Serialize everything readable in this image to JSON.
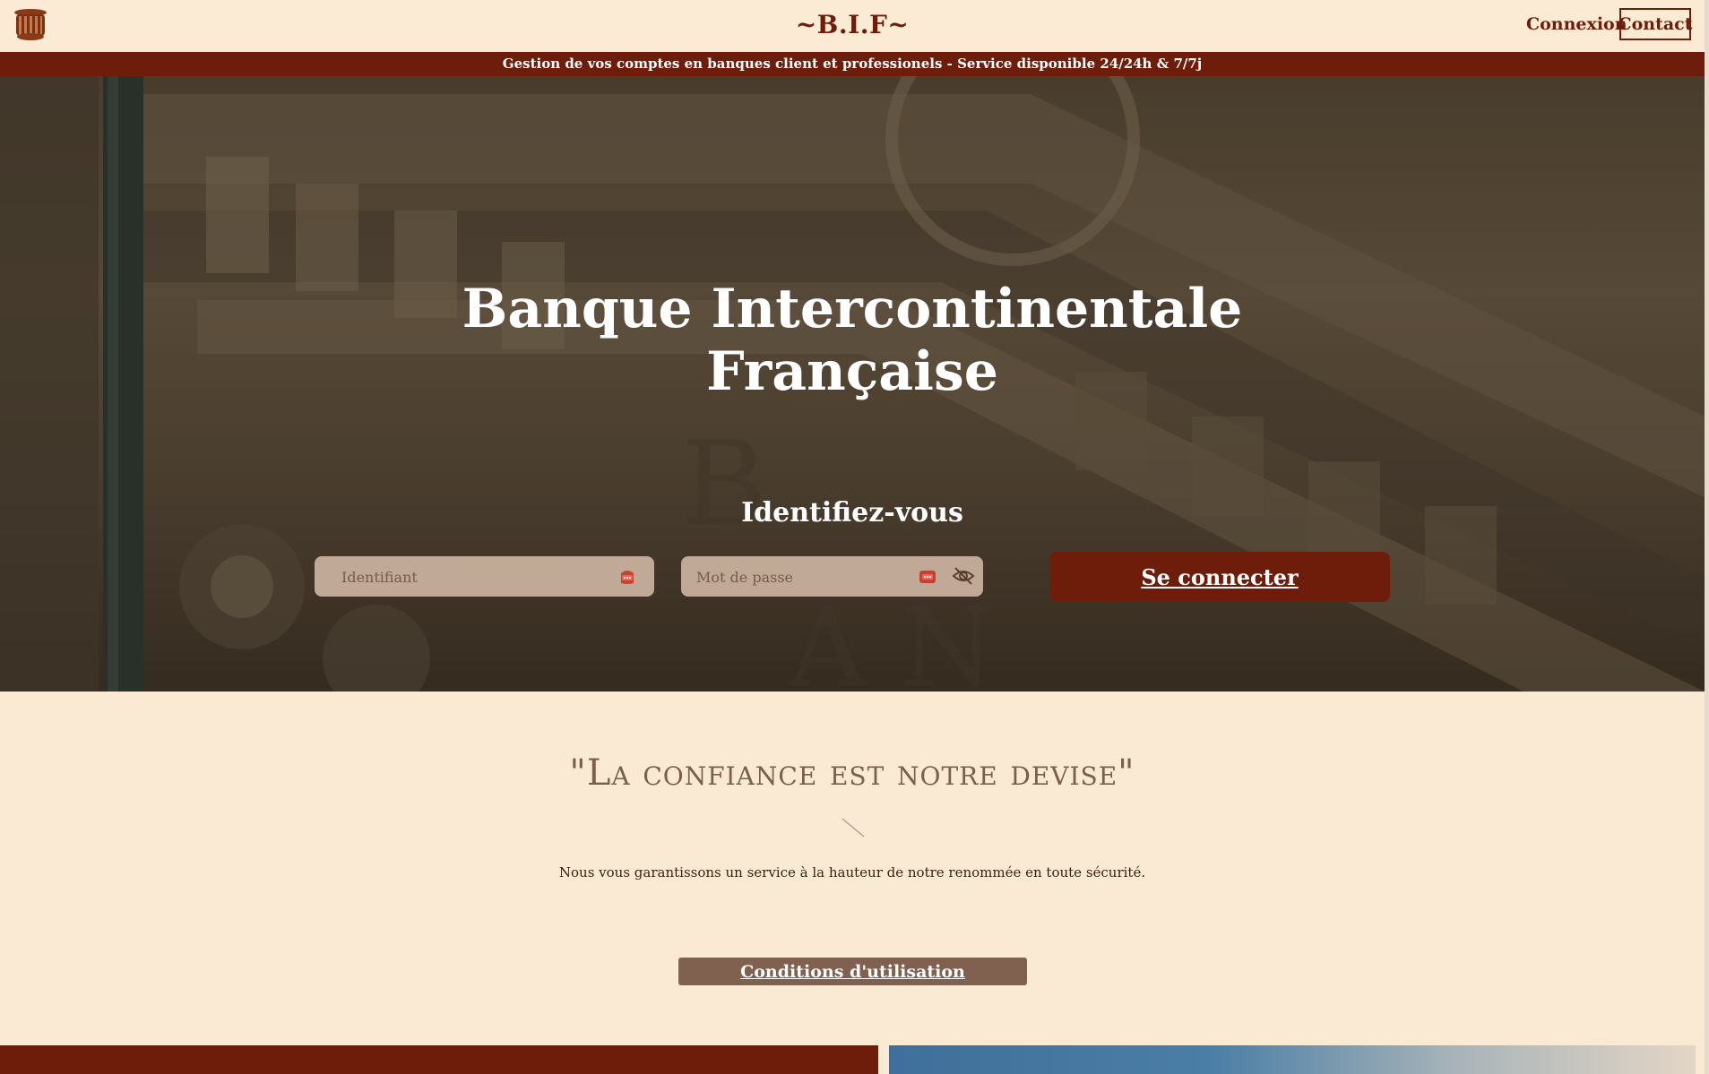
{
  "header": {
    "brand": "~B.I.F~",
    "nav": {
      "login": "Connexion",
      "contact": "Contact"
    },
    "logo_icon": "bank-column-icon",
    "banner": "Gestion de vos comptes en banques client et professionels - Service disponible 24/24h & 7/7j"
  },
  "hero": {
    "title_line1": "Banque Intercontinentale",
    "title_line2": "Française",
    "subtitle": "Identifiez-vous",
    "username_placeholder": "Identifiant",
    "password_placeholder": "Mot de passe",
    "field_icon": "password-manager-icon",
    "toggle_icon": "eye-slash-icon",
    "submit_label": "Se connecter"
  },
  "about": {
    "motto": "\"La confiance est notre devise\"",
    "description": "Nous vous garantissons un service à la hauteur de notre renommée en toute sécurité.",
    "terms_label": "Conditions d'utilisation"
  },
  "colors": {
    "primary": "#6e1d0b",
    "background": "#fbead3",
    "secondary_button": "#80614f",
    "motto_text": "#7a5f4d"
  }
}
